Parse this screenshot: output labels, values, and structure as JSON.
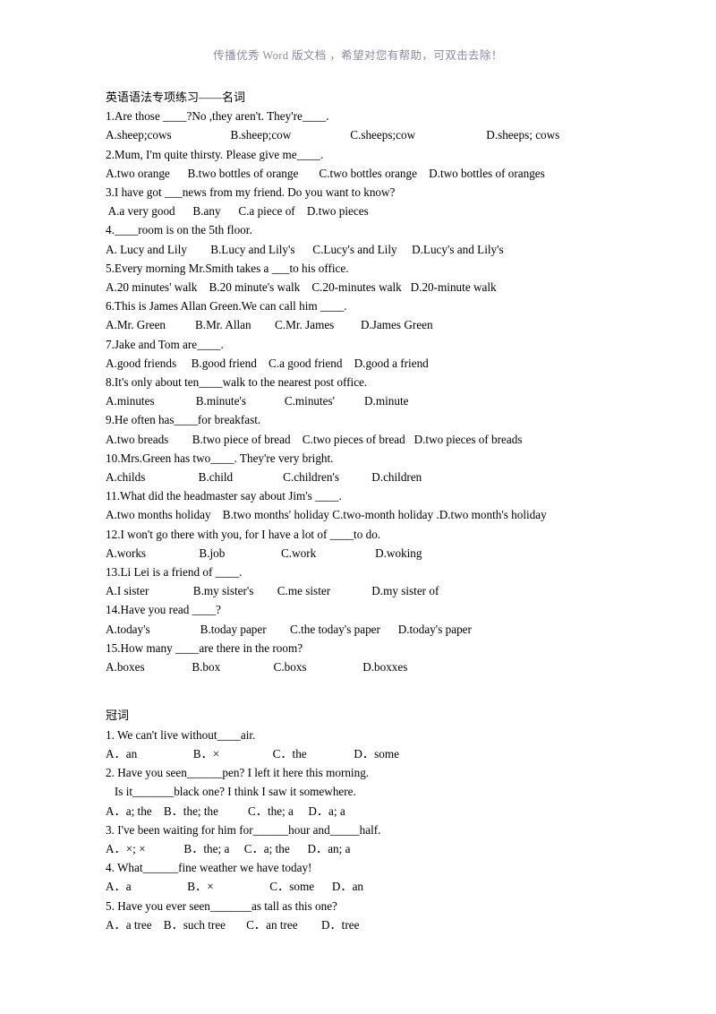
{
  "watermark": {
    "text": "传播优秀 Word 版文档 ，希望对您有帮助，可双击去除！",
    "color": "#8a8aa0"
  },
  "document": {
    "sections": [
      {
        "heading": "英语语法专项练习——名词",
        "items": [
          {
            "question": "1.Are those ____?No ,they aren't. They're____.",
            "options": "A.sheep;cows                    B.sheep;cow                    C.sheeps;cow                        D.sheeps; cows"
          },
          {
            "question": "2.Mum, I'm quite thirsty. Please give me____.",
            "options": "A.two orange      B.two bottles of orange       C.two bottles orange    D.two bottles of oranges"
          },
          {
            "question": "3.I have got ___news from my friend. Do you want to know?",
            "options": " A.a very good      B.any      C.a piece of    D.two pieces"
          },
          {
            "question": "4.____room is on the 5th floor.",
            "options": "A. Lucy and Lily        B.Lucy and Lily's      C.Lucy's and Lily     D.Lucy's and Lily's"
          },
          {
            "question": "5.Every morning Mr.Smith takes a ___to his office.",
            "options": "A.20 minutes' walk    B.20 minute's walk    C.20-minutes walk   D.20-minute walk"
          },
          {
            "question": "6.This is James Allan Green.We can call him ____.",
            "options": "A.Mr. Green          B.Mr. Allan        C.Mr. James         D.James Green"
          },
          {
            "question": "7.Jake and Tom are____.",
            "options": "A.good friends     B.good friend    C.a good friend    D.good a friend"
          },
          {
            "question": "8.It's only about ten____walk to the nearest post office.",
            "options": "A.minutes              B.minute's             C.minutes'          D.minute"
          },
          {
            "question": "9.He often has____for breakfast.",
            "options": "A.two breads        B.two piece of bread    C.two pieces of bread   D.two pieces of breads"
          },
          {
            "question": "10.Mrs.Green has two____. They're very bright.",
            "options": "A.childs                  B.child                 C.children's           D.children"
          },
          {
            "question": "11.What did the headmaster say about Jim's ____.",
            "options": "A.two months holiday    B.two months' holiday C.two-month holiday .D.two month's holiday"
          },
          {
            "question": "12.I won't go there with you, for I have a lot of ____to do.",
            "options": "A.works                  B.job                   C.work                    D.woking"
          },
          {
            "question": "13.Li Lei is a friend of ____.",
            "options": "A.I sister               B.my sister's        C.me sister              D.my sister of"
          },
          {
            "question": "14.Have you read ____?",
            "options": "A.today's                 B.today paper        C.the today's paper      D.today's paper"
          },
          {
            "question": "15.How many ____are there in the room?",
            "options": "A.boxes                B.box                  C.boxs                   D.boxxes"
          }
        ]
      },
      {
        "heading": "冠词",
        "items": [
          {
            "question": "1. We can't live without____air.",
            "options": "A．an                   B．×                  C．the                D．some"
          },
          {
            "question": "2. Have you seen______pen? I left it here this morning.",
            "question2": "   Is it_______black one? I think I saw it somewhere.",
            "options": "A．a; the    B．the; the          C．the; a     D．a; a"
          },
          {
            "question": "3. I've been waiting for him for______hour and_____half.",
            "options": "A．×; ×             B．the; a     C．a; the      D．an; a"
          },
          {
            "question": "4. What______fine weather we have today!",
            "options": "A．a                   B．×                   C．some      D．an"
          },
          {
            "question": "5. Have you ever seen_______as tall as this one?",
            "options": "A．a tree    B．such tree       C．an tree        D．tree"
          }
        ]
      }
    ]
  }
}
